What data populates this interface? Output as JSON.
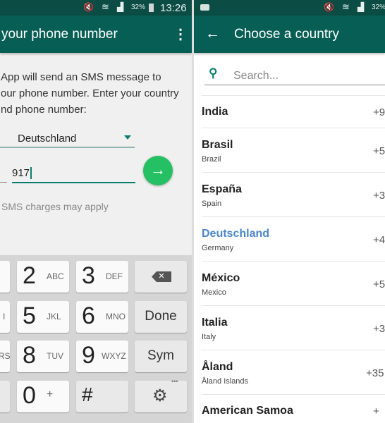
{
  "left": {
    "status": {
      "time": "13:26",
      "battery": "32%"
    },
    "title": "your phone number",
    "description": "App will send an SMS message to\nour phone number. Enter your country\nnd phone number:",
    "country": "Deutschland",
    "phone_value": "917",
    "charges_note": "SMS charges may apply",
    "keyboard": {
      "partial_col": [
        "I",
        "RS"
      ],
      "keys": [
        {
          "digit": "2",
          "letters": "ABC"
        },
        {
          "digit": "3",
          "letters": "DEF"
        },
        {
          "digit": "5",
          "letters": "JKL"
        },
        {
          "digit": "6",
          "letters": "MNO"
        },
        {
          "digit": "8",
          "letters": "TUV"
        },
        {
          "digit": "9",
          "letters": "WXYZ"
        },
        {
          "digit": "0",
          "letters": "+"
        },
        {
          "digit": "#",
          "letters": ""
        }
      ],
      "done": "Done",
      "sym": "Sym",
      "more": "•••"
    },
    "accent": "#25c063"
  },
  "right": {
    "status": {
      "battery": "32%"
    },
    "title": "Choose a country",
    "search_placeholder": "Search...",
    "countries": [
      {
        "name": "India",
        "sub": "",
        "code": "+9"
      },
      {
        "name": "Brasil",
        "sub": "Brazil",
        "code": "+5"
      },
      {
        "name": "España",
        "sub": "Spain",
        "code": "+3"
      },
      {
        "name": "Deutschland",
        "sub": "Germany",
        "code": "+4",
        "selected": true
      },
      {
        "name": "México",
        "sub": "Mexico",
        "code": "+5"
      },
      {
        "name": "Italia",
        "sub": "Italy",
        "code": "+3"
      },
      {
        "name": "Åland",
        "sub": "Åland Islands",
        "code": "+35"
      },
      {
        "name": "American Samoa",
        "sub": "",
        "code": "+"
      }
    ],
    "selected_color": "#4a86c8"
  }
}
